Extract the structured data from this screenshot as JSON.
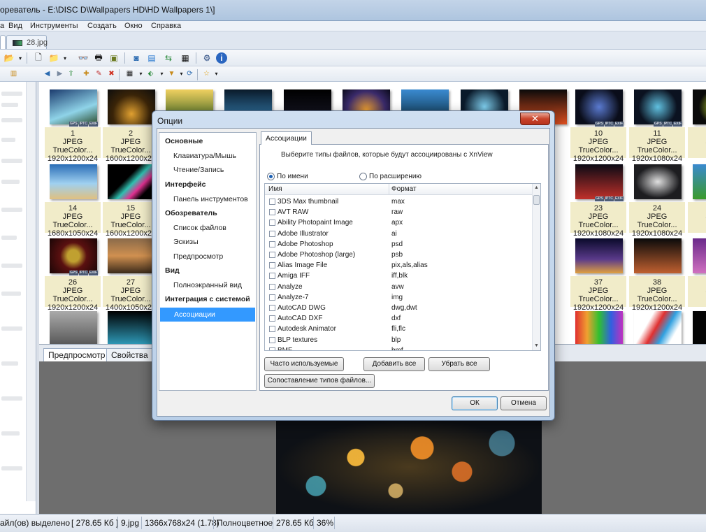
{
  "window": {
    "title": "ореватель - E:\\DISC D\\Wallpapers HD\\HD Wallpapers 1\\]"
  },
  "menu": [
    "а",
    "Вид",
    "Инструменты",
    "Создать",
    "Окно",
    "Справка"
  ],
  "doc_tabs": [
    {
      "label": ""
    },
    {
      "label": "28.jpg"
    }
  ],
  "toolbar_icons": [
    "open-icon",
    "save-icon",
    "copy-icon",
    "binoculars-icon",
    "print-icon",
    "scan-icon",
    "capture-icon",
    "slideshow-icon",
    "convert-icon",
    "calculator-icon",
    "settings-icon",
    "info-icon"
  ],
  "thumbnails": [
    {
      "num": "1",
      "type": "JPEG TrueColor...",
      "size": "1920x1200x24",
      "colors": [
        "#1b3b6e",
        "#8fd3e8"
      ]
    },
    {
      "num": "2",
      "type": "JPEG TrueColor...",
      "size": "1600x1200x24",
      "colors": [
        "#0d0d0d",
        "#c07a1e"
      ]
    },
    {
      "num": "10",
      "type": "JPEG TrueColor...",
      "size": "1920x1200x24",
      "colors": [
        "#0a0d1a",
        "#3e5f9d"
      ]
    },
    {
      "num": "11",
      "type": "JPEG TrueColor...",
      "size": "1920x1080x24",
      "colors": [
        "#0b1220",
        "#3aa0d0"
      ]
    },
    {
      "num": "14",
      "type": "JPEG TrueColor...",
      "size": "1680x1050x24",
      "colors": [
        "#2a6db6",
        "#9fd0f0"
      ]
    },
    {
      "num": "15",
      "type": "JPEG TrueColor...",
      "size": "1600x1200x24",
      "colors": [
        "#000000",
        "#30c0b0"
      ]
    },
    {
      "num": "23",
      "type": "JPEG TrueColor...",
      "size": "1920x1080x24",
      "colors": [
        "#0a0a14",
        "#c0302a"
      ]
    },
    {
      "num": "24",
      "type": "JPEG TrueColor...",
      "size": "1920x1080x24",
      "colors": [
        "#1d1d20",
        "#e0e0e0"
      ]
    },
    {
      "num": "26",
      "type": "JPEG TrueColor...",
      "size": "1920x1200x24",
      "colors": [
        "#2a0d0d",
        "#c0a030"
      ]
    },
    {
      "num": "27",
      "type": "JPEG TrueColor...",
      "size": "1400x1050x24",
      "colors": [
        "#3a2a1a",
        "#d09050"
      ]
    },
    {
      "num": "37",
      "type": "JPEG TrueColor...",
      "size": "1920x1200x24",
      "colors": [
        "#0a0a2a",
        "#e0a040"
      ]
    },
    {
      "num": "38",
      "type": "JPEG TrueColor...",
      "size": "1920x1200x24",
      "colors": [
        "#0a0a0a",
        "#c06030"
      ]
    }
  ],
  "preview_tabs": [
    "Предпросмотр",
    "Свойства"
  ],
  "status": {
    "selected": "айл(ов) выделено",
    "filesize": "[ 278.65 Кб ]",
    "name": "9.jpg",
    "dims": "1366x768x24 (1.78)",
    "colortype": "Полноцветное",
    "size2": "278.65 Кб",
    "zoom": "36%"
  },
  "dialog": {
    "title": "Опции",
    "close": "✕",
    "nav": [
      {
        "label": "Основные",
        "kind": "cat"
      },
      {
        "label": "Клавиатура/Мышь",
        "kind": "child"
      },
      {
        "label": "Чтение/Запись",
        "kind": "child"
      },
      {
        "label": "Интерфейс",
        "kind": "cat"
      },
      {
        "label": "Панель инструментов",
        "kind": "child"
      },
      {
        "label": "Обозреватель",
        "kind": "cat"
      },
      {
        "label": "Список файлов",
        "kind": "child"
      },
      {
        "label": "Эскизы",
        "kind": "child"
      },
      {
        "label": "Предпросмотр",
        "kind": "child"
      },
      {
        "label": "Вид",
        "kind": "cat"
      },
      {
        "label": "Полноэкранный вид",
        "kind": "child"
      },
      {
        "label": "Интеграция с системой",
        "kind": "cat"
      },
      {
        "label": "Ассоциации",
        "kind": "child",
        "selected": true
      }
    ],
    "tab": "Ассоциации",
    "description": "Выберите типы файлов, которые будут ассоциированы с XnView",
    "radio_by_name": "По имени",
    "radio_by_ext": "По расширению",
    "col_name": "Имя",
    "col_format": "Формат",
    "rows": [
      {
        "name": "3DS Max thumbnail",
        "format": "max"
      },
      {
        "name": "AVT RAW",
        "format": "raw"
      },
      {
        "name": "Ability Photopaint Image",
        "format": "apx"
      },
      {
        "name": "Adobe Illustrator",
        "format": "ai"
      },
      {
        "name": "Adobe Photoshop",
        "format": "psd"
      },
      {
        "name": "Adobe Photoshop (large)",
        "format": "psb"
      },
      {
        "name": "Alias Image File",
        "format": "pix,als,alias"
      },
      {
        "name": "Amiga IFF",
        "format": "iff,blk"
      },
      {
        "name": "Analyze",
        "format": "avw"
      },
      {
        "name": "Analyze-7",
        "format": "img"
      },
      {
        "name": "AutoCAD DWG",
        "format": "dwg,dwt"
      },
      {
        "name": "AutoCAD DXF",
        "format": "dxf"
      },
      {
        "name": "Autodesk Animator",
        "format": "fli,flc"
      },
      {
        "name": "BLP textures",
        "format": "blp"
      },
      {
        "name": "BMF",
        "format": "bmf"
      }
    ],
    "btn_frequent": "Часто используемые",
    "btn_add_all": "Добавить все",
    "btn_remove_all": "Убрать все",
    "btn_mapping": "Сопоставление типов файлов...",
    "btn_ok": "ОК",
    "btn_cancel": "Отмена"
  }
}
